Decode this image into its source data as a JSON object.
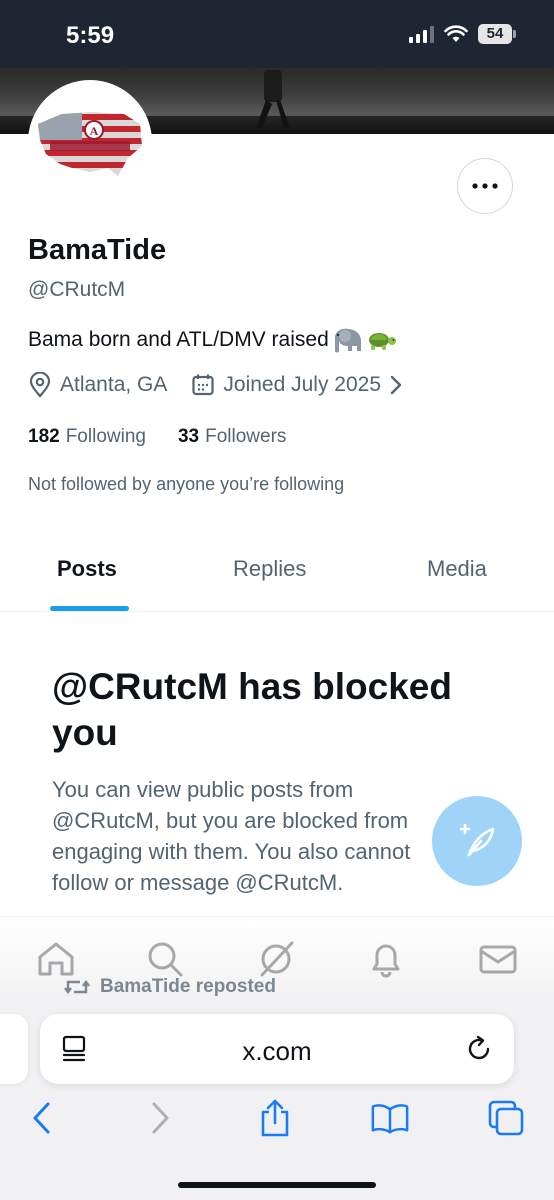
{
  "status_bar": {
    "time": "5:59",
    "battery": "54"
  },
  "profile": {
    "name": "BamaTide",
    "handle": "@CRutcM",
    "bio": "Bama born and ATL/DMV raised",
    "bio_emoji": [
      "elephant-emoji",
      "turtle-emoji"
    ],
    "location": "Atlanta, GA",
    "joined": "Joined July 2025",
    "following_count": "182",
    "following_label": "Following",
    "followers_count": "33",
    "followers_label": "Followers",
    "followed_by": "Not followed by anyone you’re following"
  },
  "tabs": [
    {
      "label": "Posts",
      "active": true
    },
    {
      "label": "Replies",
      "active": false
    },
    {
      "label": "Media",
      "active": false
    }
  ],
  "blocked": {
    "title": "@CRutcM has blocked you",
    "body": "You can view public posts from @CRutcM, but you are blocked from engaging with them. You also cannot follow or message @CRutcM."
  },
  "repost": {
    "label": "BamaTide reposted"
  },
  "nav_icons": [
    "home-icon",
    "search-icon",
    "grok-icon",
    "notifications-icon",
    "messages-icon"
  ],
  "browser": {
    "url": "x.com"
  },
  "colors": {
    "accent": "#1d9bf0",
    "fab": "#9fd3f8",
    "status_bar": "#1d2632"
  }
}
